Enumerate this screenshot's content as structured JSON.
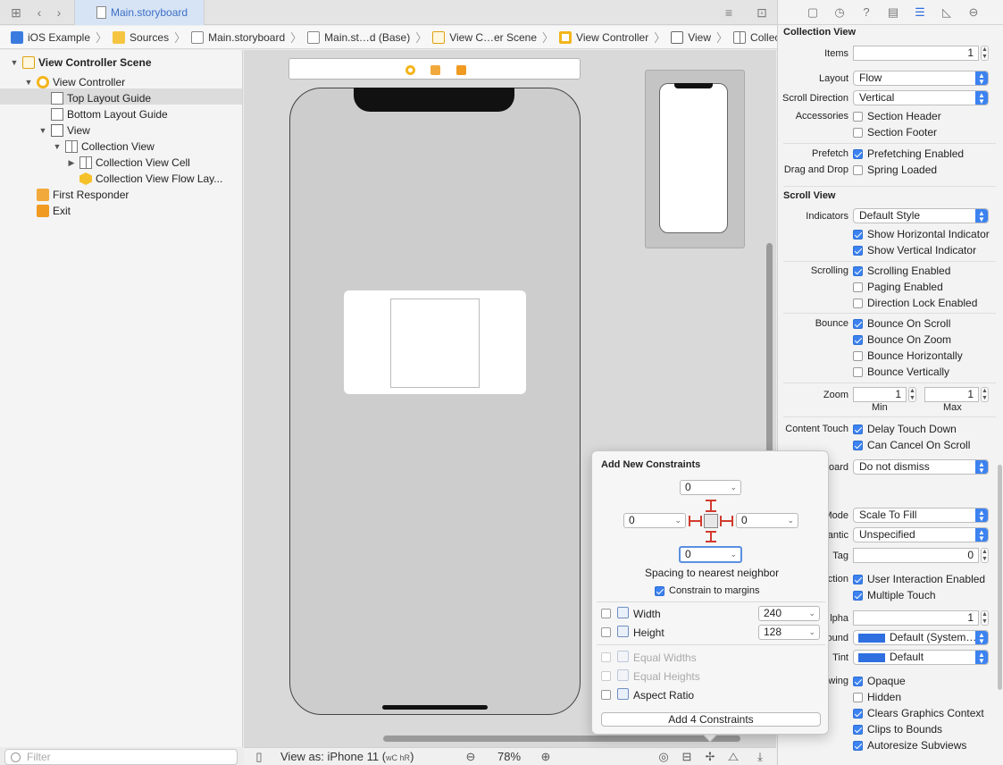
{
  "tabbar": {
    "active_tab": "Main.storyboard"
  },
  "breadcrumb": [
    "iOS Example",
    "Sources",
    "Main.storyboard",
    "Main.st…d (Base)",
    "View C…er Scene",
    "View Controller",
    "View",
    "Collection View"
  ],
  "navigator": {
    "items": [
      {
        "label": "View Controller Scene",
        "bold": true
      },
      {
        "label": "View Controller"
      },
      {
        "label": "Top Layout Guide"
      },
      {
        "label": "Bottom Layout Guide"
      },
      {
        "label": "View"
      },
      {
        "label": "Collection View"
      },
      {
        "label": "Collection View Cell"
      },
      {
        "label": "Collection View Flow Lay..."
      },
      {
        "label": "First Responder"
      },
      {
        "label": "Exit"
      }
    ],
    "filter_placeholder": "Filter"
  },
  "canvas": {
    "view_as": "View as: iPhone 11 (",
    "size_class": "wC hR",
    "view_as_close": ")",
    "zoom": "78%"
  },
  "popover": {
    "title": "Add New Constraints",
    "top": "0",
    "left": "0",
    "right": "0",
    "bottom": "0",
    "spacing_label": "Spacing to nearest neighbor",
    "constrain_margins": "Constrain to margins",
    "width_label": "Width",
    "width_value": "240",
    "height_label": "Height",
    "height_value": "128",
    "equal_widths": "Equal Widths",
    "equal_heights": "Equal Heights",
    "aspect_ratio": "Aspect Ratio",
    "add_button": "Add 4 Constraints"
  },
  "inspector": {
    "collection_view": {
      "title": "Collection View",
      "items_label": "Items",
      "items_value": "1",
      "layout_label": "Layout",
      "layout_value": "Flow",
      "scroll_dir_label": "Scroll Direction",
      "scroll_dir_value": "Vertical",
      "accessories_label": "Accessories",
      "section_header": "Section Header",
      "section_footer": "Section Footer",
      "prefetch_label": "Prefetch",
      "prefetching_enabled": "Prefetching Enabled",
      "drag_drop_label": "Drag and Drop",
      "spring_loaded": "Spring Loaded"
    },
    "scroll_view": {
      "title": "Scroll View",
      "indicators_label": "Indicators",
      "indicators_value": "Default Style",
      "show_horizontal": "Show Horizontal Indicator",
      "show_vertical": "Show Vertical Indicator",
      "scrolling_label": "Scrolling",
      "scrolling_enabled": "Scrolling Enabled",
      "paging_enabled": "Paging Enabled",
      "direction_lock": "Direction Lock Enabled",
      "bounce_label": "Bounce",
      "bounce_on_scroll": "Bounce On Scroll",
      "bounce_on_zoom": "Bounce On Zoom",
      "bounce_horizontally": "Bounce Horizontally",
      "bounce_vertically": "Bounce Vertically",
      "zoom_label": "Zoom",
      "zoom_min_value": "1",
      "zoom_max_value": "1",
      "zoom_min": "Min",
      "zoom_max": "Max",
      "content_touch_label": "Content Touch",
      "delay_touch_down": "Delay Touch Down",
      "can_cancel_on_scroll": "Can Cancel On Scroll",
      "keyboard_label": "oard",
      "keyboard_value": "Do not dismiss"
    },
    "view": {
      "mode_label": "Mode",
      "mode_value": "Scale To Fill",
      "semantic_label": "antic",
      "semantic_value": "Unspecified",
      "tag_label": "Tag",
      "tag_value": "0",
      "interaction_label": "ction",
      "user_interaction": "User Interaction Enabled",
      "multiple_touch": "Multiple Touch",
      "alpha_label": "lpha",
      "alpha_value": "1",
      "background_label": "ound",
      "background_value": "Default (System…",
      "tint_label": "Tint",
      "tint_value": "Default",
      "drawing_label": "wing",
      "opaque": "Opaque",
      "hidden": "Hidden",
      "clears_graphics": "Clears Graphics Context",
      "clips_to_bounds": "Clips to Bounds",
      "autoresize_subviews": "Autoresize Subviews"
    }
  },
  "colors": {
    "accent": "#3c82f0",
    "selection": "#dcdcdc",
    "warning": "#f2b51b",
    "constraint_red": "#d23a2e"
  }
}
